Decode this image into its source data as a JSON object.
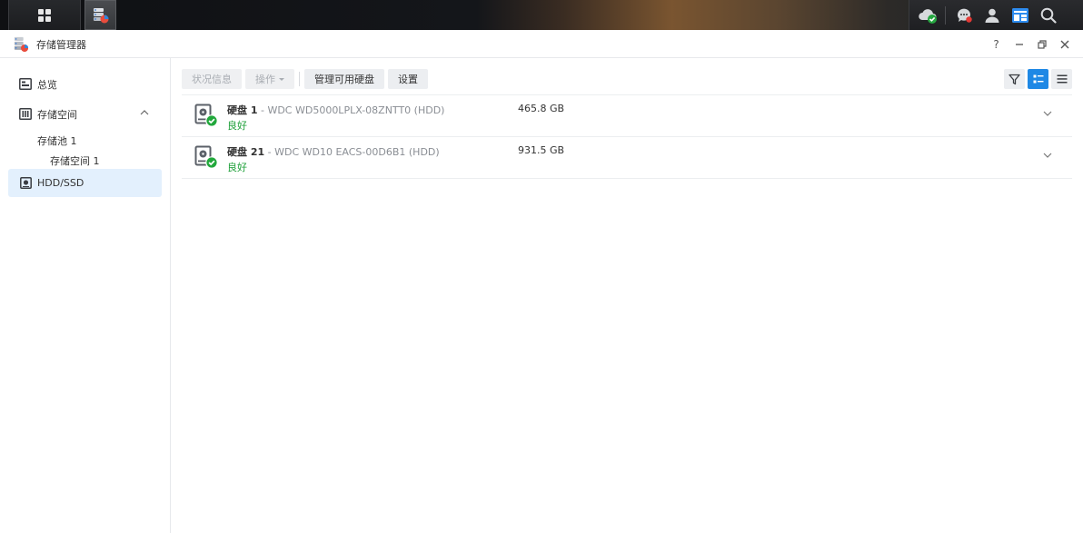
{
  "window": {
    "title": "存储管理器",
    "controls": {
      "help": "?",
      "minimize": "—",
      "close": "✕"
    }
  },
  "sidebar": {
    "items": [
      {
        "label": "总览",
        "icon": "overview-icon"
      },
      {
        "label": "存储空间",
        "icon": "storage-icon"
      },
      {
        "label": "HDD/SSD",
        "icon": "hdd-icon"
      }
    ],
    "pool": "存储池 1",
    "volume": "存储空间 1"
  },
  "toolbar": {
    "status_label": "状况信息",
    "action_label": "操作",
    "manage_label": "管理可用硬盘",
    "settings_label": "设置"
  },
  "disks": [
    {
      "name": "硬盘 1",
      "model": " - WDC WD5000LPLX-08ZNTT0 (HDD)",
      "status": "良好",
      "size": "465.8 GB"
    },
    {
      "name": "硬盘 21",
      "model": " - WDC WD10 EACS-00D6B1 (HDD)",
      "status": "良好",
      "size": "931.5 GB"
    }
  ],
  "colors": {
    "accent": "#1e88e5",
    "status_ok": "#1fa03a",
    "active_bg": "#e3f0fd"
  }
}
